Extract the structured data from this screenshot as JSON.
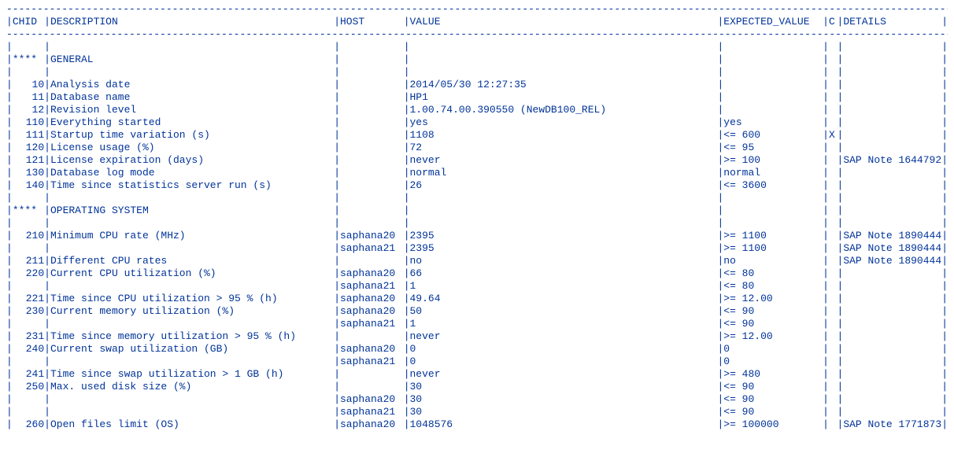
{
  "headers": {
    "chid": "CHID",
    "description": "DESCRIPTION",
    "host": "HOST",
    "value": "VALUE",
    "expected_value": "EXPECTED_VALUE",
    "c": "C",
    "details": "DETAILS"
  },
  "dashes": {
    "full": "------------------------------------------------------------------------------------------------------------------------------------------------------------------------"
  },
  "sections": [
    {
      "chid": "****",
      "title": "GENERAL",
      "rows": [
        {
          "chid": "",
          "desc": "",
          "host": "",
          "value": "",
          "exp": "",
          "c": "",
          "det": ""
        },
        {
          "chid": "10",
          "desc": "Analysis date",
          "host": "",
          "value": "2014/05/30 12:27:35",
          "exp": "",
          "c": "",
          "det": ""
        },
        {
          "chid": "11",
          "desc": "Database name",
          "host": "",
          "value": "HP1",
          "exp": "",
          "c": "",
          "det": ""
        },
        {
          "chid": "12",
          "desc": "Revision level",
          "host": "",
          "value": "1.00.74.00.390550 (NewDB100_REL)",
          "exp": "",
          "c": "",
          "det": ""
        },
        {
          "chid": "110",
          "desc": "Everything started",
          "host": "",
          "value": "yes",
          "exp": "yes",
          "c": "",
          "det": ""
        },
        {
          "chid": "111",
          "desc": "Startup time variation (s)",
          "host": "",
          "value": "1108",
          "exp": "<= 600",
          "c": "X",
          "det": ""
        },
        {
          "chid": "120",
          "desc": "License usage (%)",
          "host": "",
          "value": "72",
          "exp": "<= 95",
          "c": "",
          "det": ""
        },
        {
          "chid": "121",
          "desc": "License expiration (days)",
          "host": "",
          "value": "never",
          "exp": ">= 100",
          "c": "",
          "det": "SAP Note 1644792"
        },
        {
          "chid": "130",
          "desc": "Database log mode",
          "host": "",
          "value": "normal",
          "exp": "normal",
          "c": "",
          "det": ""
        },
        {
          "chid": "140",
          "desc": "Time since statistics server run (s)",
          "host": "",
          "value": "26",
          "exp": "<= 3600",
          "c": "",
          "det": ""
        },
        {
          "chid": "",
          "desc": "",
          "host": "",
          "value": "",
          "exp": "",
          "c": "",
          "det": ""
        }
      ]
    },
    {
      "chid": "****",
      "title": "OPERATING SYSTEM",
      "rows": [
        {
          "chid": "",
          "desc": "",
          "host": "",
          "value": "",
          "exp": "",
          "c": "",
          "det": ""
        },
        {
          "chid": "210",
          "desc": "Minimum CPU rate (MHz)",
          "host": "saphana20",
          "value": "2395",
          "exp": ">= 1100",
          "c": "",
          "det": "SAP Note 1890444"
        },
        {
          "chid": "",
          "desc": "",
          "host": "saphana21",
          "value": "2395",
          "exp": ">= 1100",
          "c": "",
          "det": "SAP Note 1890444"
        },
        {
          "chid": "211",
          "desc": "Different CPU rates",
          "host": "",
          "value": "no",
          "exp": "no",
          "c": "",
          "det": "SAP Note 1890444"
        },
        {
          "chid": "220",
          "desc": "Current CPU utilization (%)",
          "host": "saphana20",
          "value": "66",
          "exp": "<= 80",
          "c": "",
          "det": ""
        },
        {
          "chid": "",
          "desc": "",
          "host": "saphana21",
          "value": "1",
          "exp": "<= 80",
          "c": "",
          "det": ""
        },
        {
          "chid": "221",
          "desc": "Time since CPU utilization > 95 % (h)",
          "host": "saphana20",
          "value": "49.64",
          "exp": ">= 12.00",
          "c": "",
          "det": ""
        },
        {
          "chid": "230",
          "desc": "Current memory utilization (%)",
          "host": "saphana20",
          "value": "50",
          "exp": "<= 90",
          "c": "",
          "det": ""
        },
        {
          "chid": "",
          "desc": "",
          "host": "saphana21",
          "value": "1",
          "exp": "<= 90",
          "c": "",
          "det": ""
        },
        {
          "chid": "231",
          "desc": "Time since memory utilization > 95 % (h)",
          "host": "",
          "value": "never",
          "exp": ">= 12.00",
          "c": "",
          "det": ""
        },
        {
          "chid": "240",
          "desc": "Current swap utilization (GB)",
          "host": "saphana20",
          "value": "0",
          "exp": "0",
          "c": "",
          "det": ""
        },
        {
          "chid": "",
          "desc": "",
          "host": "saphana21",
          "value": "0",
          "exp": "0",
          "c": "",
          "det": ""
        },
        {
          "chid": "241",
          "desc": "Time since swap utilization > 1 GB (h)",
          "host": "",
          "value": "never",
          "exp": ">= 480",
          "c": "",
          "det": ""
        },
        {
          "chid": "250",
          "desc": "Max. used disk size (%)",
          "host": "",
          "value": "30",
          "exp": "<= 90",
          "c": "",
          "det": ""
        },
        {
          "chid": "",
          "desc": "",
          "host": "saphana20",
          "value": "30",
          "exp": "<= 90",
          "c": "",
          "det": ""
        },
        {
          "chid": "",
          "desc": "",
          "host": "saphana21",
          "value": "30",
          "exp": "<= 90",
          "c": "",
          "det": ""
        },
        {
          "chid": "260",
          "desc": "Open files limit (OS)",
          "host": "saphana20",
          "value": "1048576",
          "exp": ">= 100000",
          "c": "",
          "det": "SAP Note 1771873"
        }
      ]
    }
  ]
}
